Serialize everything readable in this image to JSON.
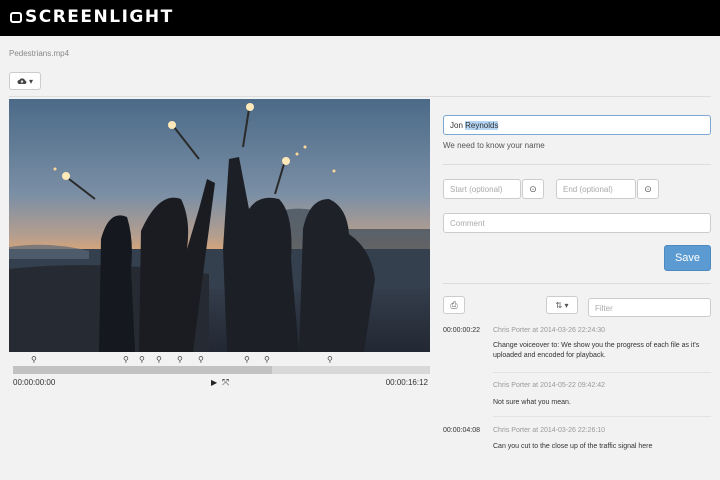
{
  "header": {
    "logo_text": "SCREENLIGHT"
  },
  "file": {
    "name": "Pedestrians.mp4"
  },
  "toolbar": {
    "upload_icon": "cloud-upload-icon",
    "upload_caret": "▾"
  },
  "player": {
    "current_time": "00:00:00:00",
    "duration": "00:00:16:12",
    "progress": 0.62,
    "marker_glyph": "⚲",
    "markers": [
      0.05,
      0.27,
      0.31,
      0.35,
      0.4,
      0.45,
      0.56,
      0.61,
      0.76
    ],
    "play_glyph": "▶",
    "fullscreen_glyph": "⤧"
  },
  "form": {
    "name_prefix": "Jon ",
    "name_selected": "Reynolds",
    "name_help": "We need to know your name",
    "start_placeholder": "Start (optional)",
    "end_placeholder": "End (optional)",
    "comment_placeholder": "Comment",
    "clock_glyph": "⊙",
    "save_label": "Save"
  },
  "comments_toolbar": {
    "print_glyph": "⎙",
    "sort_glyph": "⇅ ▾",
    "filter_placeholder": "Filter"
  },
  "comments": [
    {
      "timestamp": "00:00:00:22",
      "meta": "Chris Porter at 2014-03-26 22:24:30",
      "text": "Change voiceover to: We show you the progress of each file as it's uploaded and encoded for playback."
    },
    {
      "timestamp": "",
      "meta": "Chris Porter at 2014-05-22 09:42:42",
      "text": "Not sure what you mean."
    },
    {
      "timestamp": "00:00:04:08",
      "meta": "Chris Porter at 2014-03-26 22:26:10",
      "text": "Can you cut to the close up of the traffic signal here"
    }
  ]
}
